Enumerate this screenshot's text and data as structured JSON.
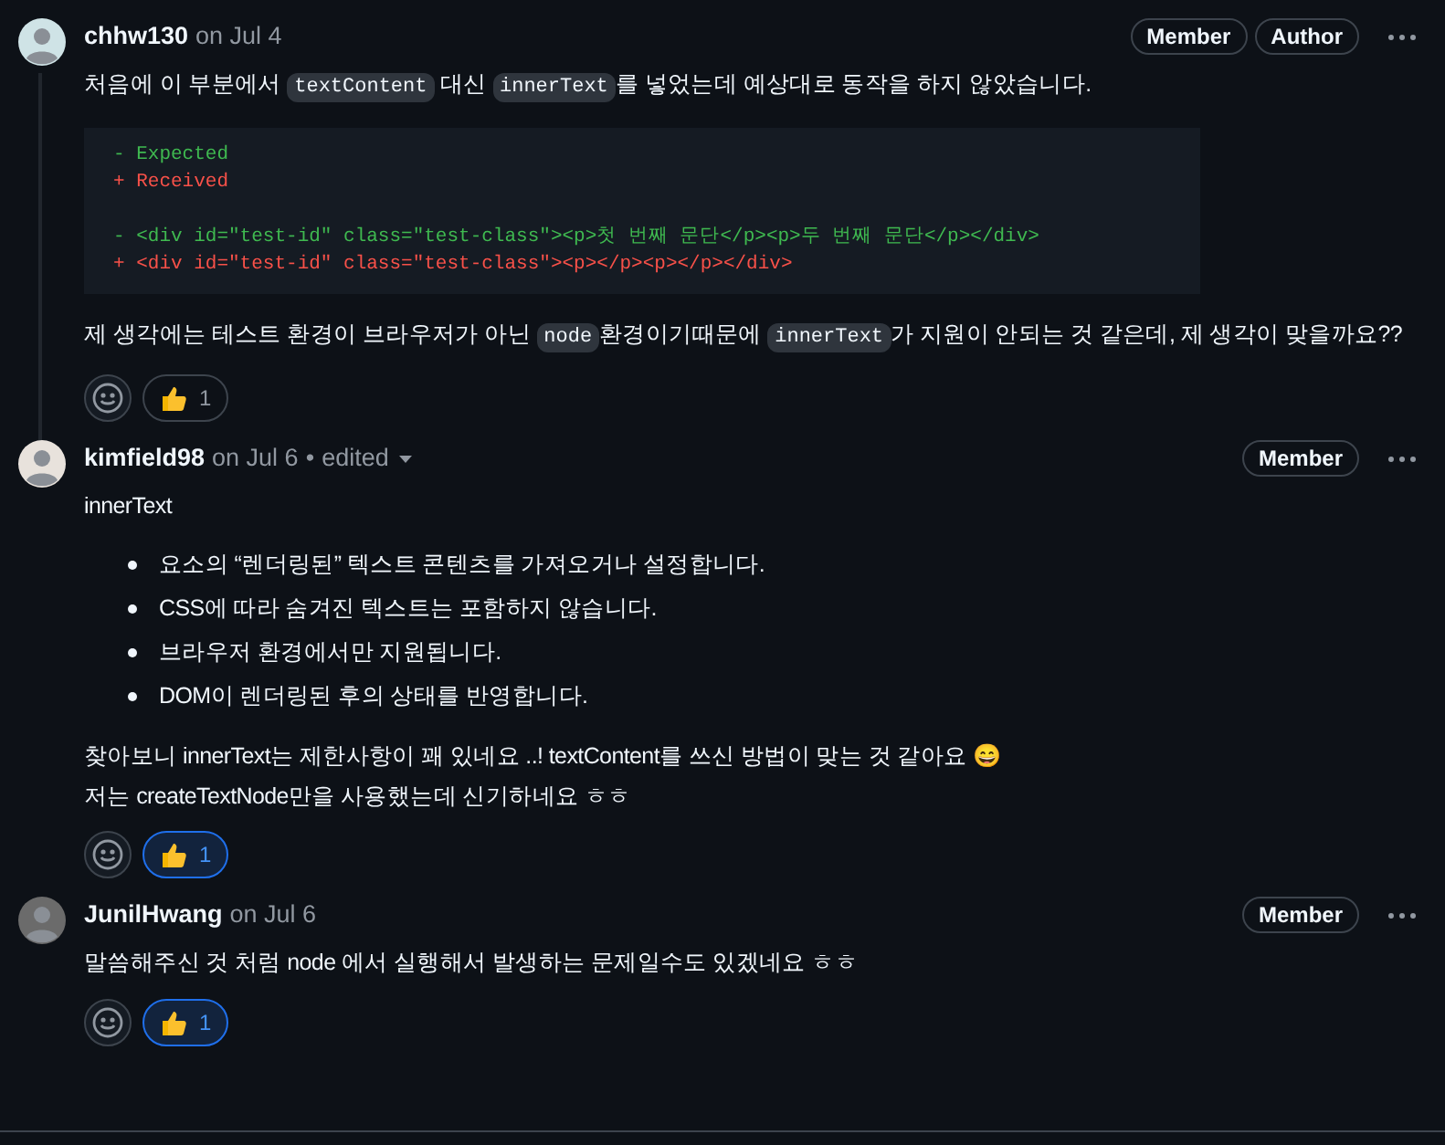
{
  "comments": [
    {
      "author": "chhw130",
      "date": "on Jul 4",
      "edited": false,
      "badges": [
        "Member",
        "Author"
      ],
      "blocks": [
        {
          "kind": "paragraph",
          "segments": [
            {
              "text": "처음에 이 부분에서 ",
              "code": false
            },
            {
              "text": "textContent",
              "code": true
            },
            {
              "text": " 대신 ",
              "code": false
            },
            {
              "text": "innerText",
              "code": true
            },
            {
              "text": "를 넣었는데 예상대로 동작을 하지 않았습니다.",
              "code": false
            }
          ]
        },
        {
          "kind": "code",
          "lines": [
            {
              "kind": "removed",
              "text": "- Expected"
            },
            {
              "kind": "added",
              "text": "+ Received"
            },
            {
              "kind": "blank"
            },
            {
              "kind": "removed",
              "text": "- <div id=\"test-id\" class=\"test-class\"><p>첫 번째 문단</p><p>두 번째 문단</p></div>"
            },
            {
              "kind": "added",
              "text": "+ <div id=\"test-id\" class=\"test-class\"><p></p><p></p></div>"
            }
          ]
        },
        {
          "kind": "paragraph",
          "segments": [
            {
              "text": "제 생각에는 테스트 환경이 브라우저가 아닌 ",
              "code": false
            },
            {
              "text": "node",
              "code": true
            },
            {
              "text": "환경이기때문에 ",
              "code": false
            },
            {
              "text": "innerText",
              "code": true
            },
            {
              "text": "가 지원이 안되는 것 같은데, 제 생각이 맞을까요??",
              "code": false
            }
          ]
        }
      ],
      "reactions": [
        {
          "count": "1",
          "selected": false
        }
      ]
    },
    {
      "author": "kimfield98",
      "date": "on Jul 6",
      "edited": true,
      "edited_separator": "•",
      "edited_label": "edited",
      "badges": [
        "Member"
      ],
      "blocks": [
        {
          "kind": "paragraph",
          "segments": [
            {
              "text": "innerText",
              "code": false
            }
          ]
        },
        {
          "kind": "list",
          "items": [
            "요소의 “렌더링된” 텍스트 콘텐츠를 가져오거나 설정합니다.",
            "CSS에 따라 숨겨진 텍스트는 포함하지 않습니다.",
            "브라우저 환경에서만 지원됩니다.",
            "DOM이 렌더링된 후의 상태를 반영합니다."
          ]
        },
        {
          "kind": "lines",
          "lines": [
            "찾아보니 innerText는 제한사항이 꽤 있네요 ..! textContent를 쓰신 방법이 맞는 것 같아요 😄",
            "저는 createTextNode만을 사용했는데 신기하네요 ㅎㅎ"
          ]
        }
      ],
      "reactions": [
        {
          "count": "1",
          "selected": true
        }
      ]
    },
    {
      "author": "JunilHwang",
      "date": "on Jul 6",
      "edited": false,
      "badges": [
        "Member"
      ],
      "blocks": [
        {
          "kind": "paragraph",
          "segments": [
            {
              "text": "말씀해주신 것 처럼 node 에서 실행해서 발생하는 문제일수도 있겠네요 ㅎㅎ",
              "code": false
            }
          ]
        }
      ],
      "reactions": [
        {
          "count": "1",
          "selected": true
        }
      ]
    }
  ]
}
